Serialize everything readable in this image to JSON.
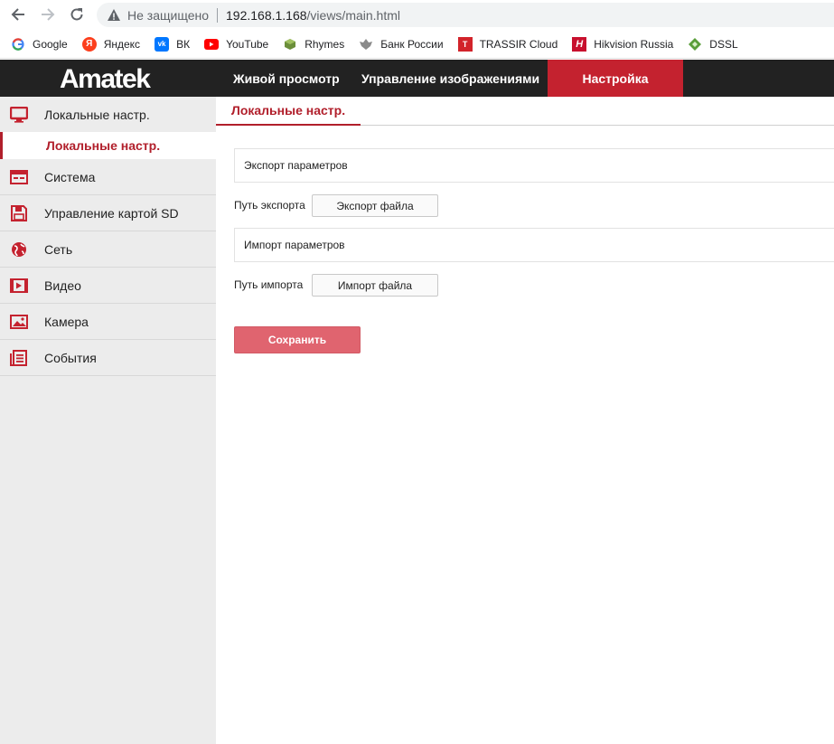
{
  "browser": {
    "security_text": "Не защищено",
    "url_host": "192.168.1.168",
    "url_path": "/views/main.html",
    "bookmarks": [
      {
        "label": "Google",
        "icon": "google-icon"
      },
      {
        "label": "Яндекс",
        "icon": "yandex-icon"
      },
      {
        "label": "ВК",
        "icon": "vk-icon"
      },
      {
        "label": "YouTube",
        "icon": "youtube-icon"
      },
      {
        "label": "Rhymes",
        "icon": "rhymes-icon"
      },
      {
        "label": "Банк России",
        "icon": "bank-icon"
      },
      {
        "label": "TRASSIR Cloud",
        "icon": "trassir-icon"
      },
      {
        "label": "Hikvision Russia",
        "icon": "hikvision-icon"
      },
      {
        "label": "DSSL",
        "icon": "dssl-icon"
      }
    ]
  },
  "header": {
    "logo": "Amatek",
    "tabs": [
      {
        "label": "Живой просмотр"
      },
      {
        "label": "Управление изображениями"
      },
      {
        "label": "Настройка",
        "active": true
      }
    ],
    "accent_color": "#c4222f"
  },
  "sidebar": {
    "items": [
      {
        "label": "Локальные настр.",
        "icon": "monitor-icon"
      },
      {
        "label": "Система",
        "icon": "system-icon"
      },
      {
        "label": "Управление картой SD",
        "icon": "sd-card-icon"
      },
      {
        "label": "Сеть",
        "icon": "globe-icon"
      },
      {
        "label": "Видео",
        "icon": "video-icon"
      },
      {
        "label": "Камера",
        "icon": "image-icon"
      },
      {
        "label": "События",
        "icon": "events-icon"
      }
    ],
    "active_sub": "Локальные настр."
  },
  "main": {
    "tab": "Локальные настр.",
    "export_section": "Экспорт параметров",
    "export_label": "Путь экспорта",
    "export_button": "Экспорт файла",
    "import_section": "Импорт параметров",
    "import_label": "Путь импорта",
    "import_button": "Импорт файла",
    "save_button": "Сохранить"
  }
}
